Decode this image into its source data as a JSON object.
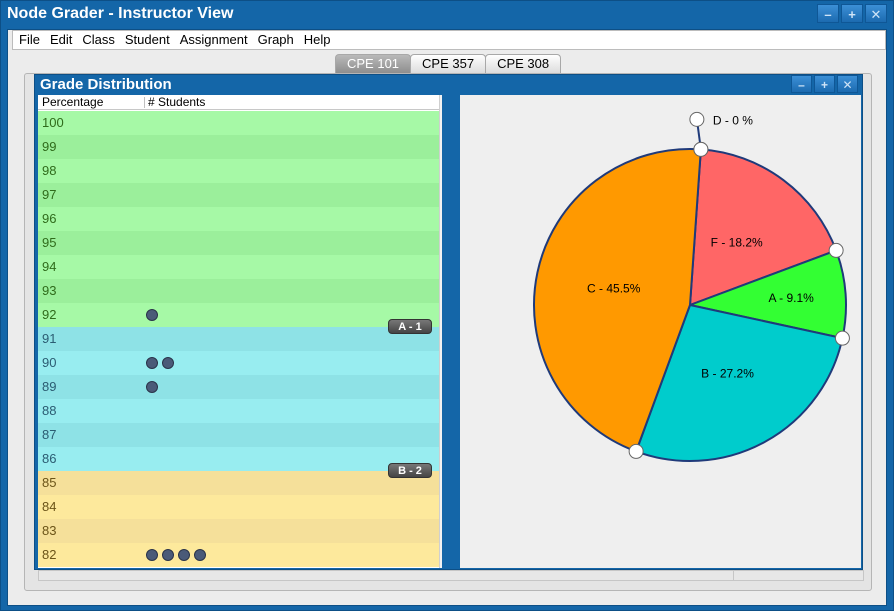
{
  "window": {
    "title": "Node Grader - Instructor View",
    "controls": [
      "–",
      "+",
      "✕"
    ]
  },
  "menu": [
    "File",
    "Edit",
    "Class",
    "Student",
    "Assignment",
    "Graph",
    "Help"
  ],
  "tabs": [
    {
      "label": "CPE 101",
      "active": true
    },
    {
      "label": "CPE 357",
      "active": false
    },
    {
      "label": "CPE 308",
      "active": false
    }
  ],
  "panel": {
    "title": "Grade Distribution",
    "controls": [
      "–",
      "+",
      "✕"
    ],
    "columns": {
      "percentage": "Percentage",
      "students": "# Students"
    },
    "rows": [
      {
        "pct": "100",
        "students": 0,
        "grade": "a"
      },
      {
        "pct": "99",
        "students": 0,
        "grade": "a"
      },
      {
        "pct": "98",
        "students": 0,
        "grade": "a"
      },
      {
        "pct": "97",
        "students": 0,
        "grade": "a"
      },
      {
        "pct": "96",
        "students": 0,
        "grade": "a"
      },
      {
        "pct": "95",
        "students": 0,
        "grade": "a"
      },
      {
        "pct": "94",
        "students": 0,
        "grade": "a"
      },
      {
        "pct": "93",
        "students": 0,
        "grade": "a"
      },
      {
        "pct": "92",
        "students": 1,
        "grade": "a"
      },
      {
        "pct": "91",
        "students": 0,
        "grade": "b"
      },
      {
        "pct": "90",
        "students": 2,
        "grade": "b"
      },
      {
        "pct": "89",
        "students": 1,
        "grade": "b"
      },
      {
        "pct": "88",
        "students": 0,
        "grade": "b"
      },
      {
        "pct": "87",
        "students": 0,
        "grade": "b"
      },
      {
        "pct": "86",
        "students": 0,
        "grade": "b"
      },
      {
        "pct": "85",
        "students": 0,
        "grade": "c"
      },
      {
        "pct": "84",
        "students": 0,
        "grade": "c"
      },
      {
        "pct": "83",
        "students": 0,
        "grade": "c"
      },
      {
        "pct": "82",
        "students": 4,
        "grade": "c"
      }
    ],
    "tags": [
      {
        "label": "A - 1",
        "after_row": 8
      },
      {
        "label": "B - 2",
        "after_row": 14
      }
    ]
  },
  "chart_data": {
    "type": "pie",
    "slices": [
      {
        "label": "D - 0 %",
        "value": 0,
        "color": "#ffffff"
      },
      {
        "label": "F - 18.2%",
        "value": 18.2,
        "color": "#ff6666"
      },
      {
        "label": "A - 9.1%",
        "value": 9.1,
        "color": "#33ff33"
      },
      {
        "label": "B - 27.2%",
        "value": 27.2,
        "color": "#00cccc"
      },
      {
        "label": "C - 45.5%",
        "value": 45.5,
        "color": "#ff9900"
      }
    ],
    "border_color": "#1f3a7a"
  },
  "colors": {
    "window_blue": "#1466a8",
    "grade_a": "#a6f9a6",
    "grade_b": "#98edf0",
    "grade_c": "#fde99c",
    "student_dot": "#4a5a78"
  }
}
